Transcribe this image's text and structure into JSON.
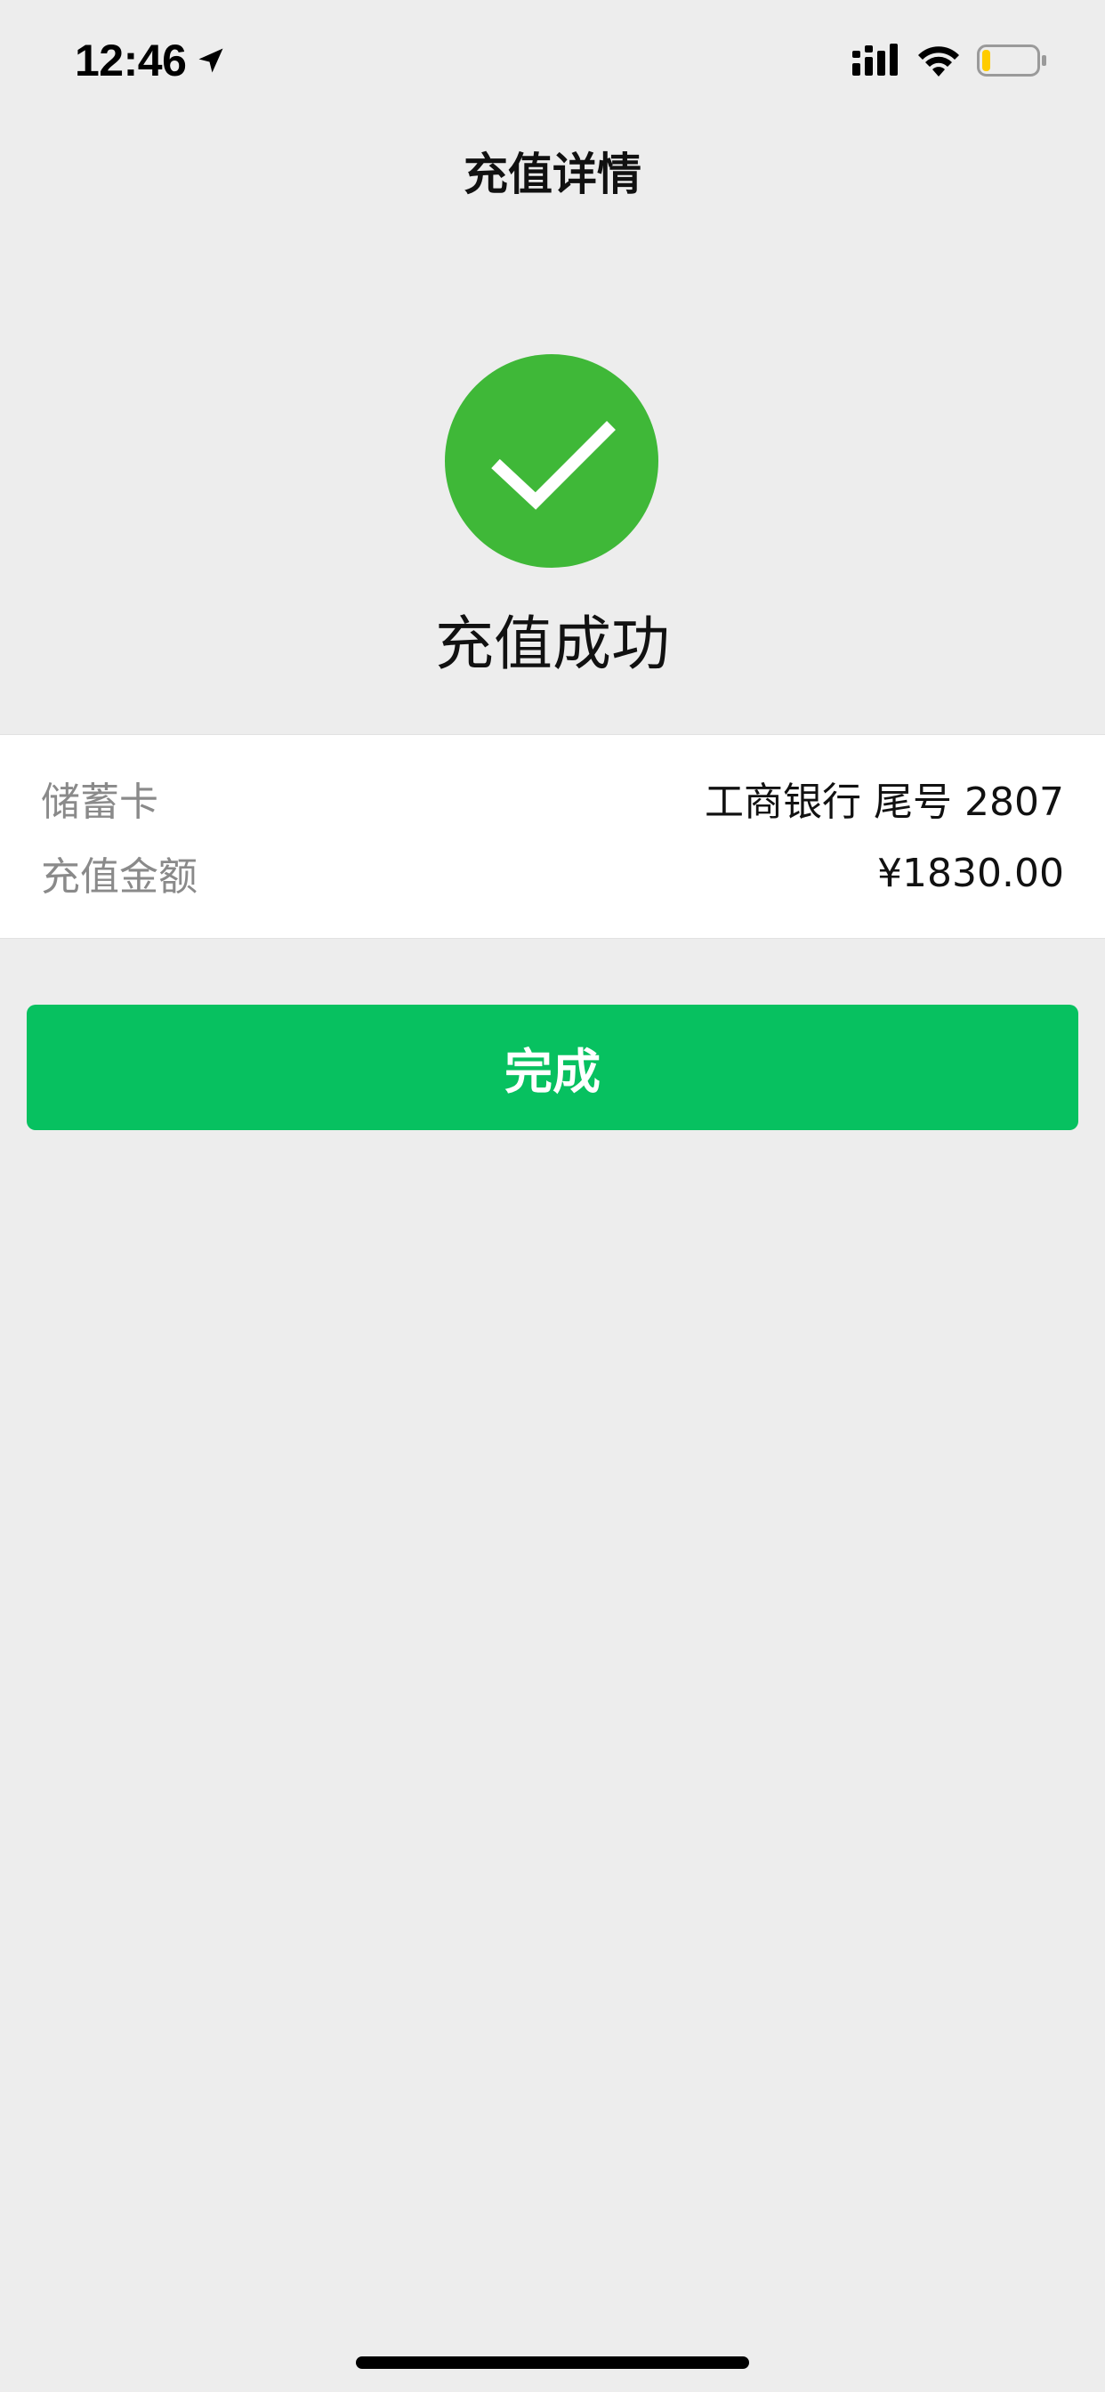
{
  "status_bar": {
    "time": "12:46",
    "icons": {
      "location": "location-arrow-icon",
      "signal": "cellular-signal-icon",
      "wifi": "wifi-icon",
      "battery": "battery-icon"
    },
    "battery_level": 0.15,
    "battery_color": "#ffcc00"
  },
  "header": {
    "title": "充值详情"
  },
  "success": {
    "icon": "check-icon",
    "circle_color": "#3fb838",
    "title": "充值成功"
  },
  "details": {
    "rows": [
      {
        "label": "储蓄卡",
        "value": "工商银行 尾号 2807"
      },
      {
        "label": "充值金额",
        "value": "¥1830.00"
      }
    ]
  },
  "actions": {
    "done_label": "完成",
    "done_color": "#07c160"
  }
}
